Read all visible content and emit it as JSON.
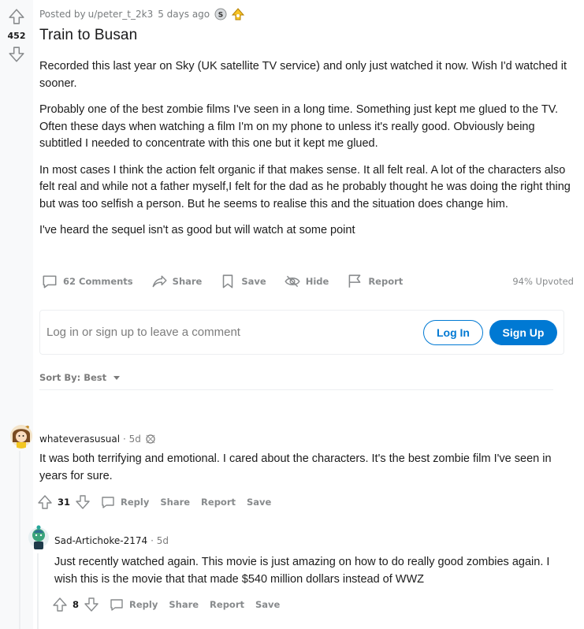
{
  "post": {
    "author_prefix": "Posted by",
    "author": "u/peter_t_2k3",
    "time": "5 days ago",
    "score": "452",
    "title": "Train to Busan",
    "paragraphs": [
      "Recorded this last year on Sky (UK satellite TV service) and only just watched it now. Wish I'd watched it sooner.",
      "Probably one of the best zombie films I've seen in a long time. Something just kept me glued to the TV. Often these days when watching a film I'm on my phone to unless it's really good. Obviously being subtitled I needed to concentrate with this one but it kept me glued.",
      "In most cases I think the action felt organic if that makes sense. It all felt real. A lot of the characters also felt real and while not a father myself,I felt for the dad as he probably thought he was doing the right thing but was too selfish a person. But he seems to realise this and the situation does change him.",
      "I've heard the sequel isn't as good but will watch at some point"
    ],
    "actions": {
      "comments": "62 Comments",
      "share": "Share",
      "save": "Save",
      "hide": "Hide",
      "report": "Report"
    },
    "upvoted": "94% Upvoted"
  },
  "login": {
    "prompt": "Log in or sign up to leave a comment",
    "login_label": "Log In",
    "signup_label": "Sign Up"
  },
  "sort": {
    "label": "Sort By: Best"
  },
  "comments": [
    {
      "author": "whateverasusual",
      "time": "· 5d",
      "text": "It was both terrifying and emotional. I cared about the characters. It's the best zombie film I've seen in years for sure.",
      "score": "31",
      "reply": "Reply",
      "share": "Share",
      "report": "Report",
      "save": "Save"
    },
    {
      "author": "Sad-Artichoke-2174",
      "time": "· 5d",
      "text": "Just recently watched again. This movie is just amazing on how to do really good zombies again. I wish this is the movie that that made $540 million dollars instead of WWZ",
      "score": "8",
      "reply": "Reply",
      "share": "Share",
      "report": "Report",
      "save": "Save"
    }
  ],
  "colors": {
    "accent": "#0079d3",
    "meta": "#787c7e",
    "action": "#878a8c"
  }
}
